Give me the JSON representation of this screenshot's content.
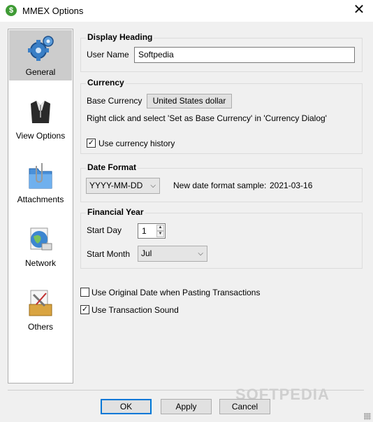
{
  "window": {
    "title": "MMEX Options",
    "app_icon": "$",
    "close_glyph": "✕"
  },
  "sidebar": {
    "items": [
      {
        "label": "General",
        "icon": "gear-icon",
        "active": true
      },
      {
        "label": "View Options",
        "icon": "view-options-icon",
        "active": false
      },
      {
        "label": "Attachments",
        "icon": "paperclip-folder-icon",
        "active": false
      },
      {
        "label": "Network",
        "icon": "globe-icon",
        "active": false
      },
      {
        "label": "Others",
        "icon": "toolbox-icon",
        "active": false
      }
    ]
  },
  "display_heading": {
    "title": "Display Heading",
    "user_name_label": "User Name",
    "user_name_value": "Softpedia"
  },
  "currency": {
    "title": "Currency",
    "base_currency_label": "Base Currency",
    "base_currency_button": "United States dollar",
    "hint": "Right click and select 'Set as Base Currency' in 'Currency Dialog'",
    "use_history_label": "Use currency history",
    "use_history_checked": true
  },
  "date_format": {
    "title": "Date Format",
    "selected_format": "YYYY-MM-DD",
    "sample_label": "New date format sample:",
    "sample_value": "2021-03-16"
  },
  "financial_year": {
    "title": "Financial Year",
    "start_day_label": "Start Day",
    "start_day_value": "1",
    "start_month_label": "Start Month",
    "start_month_value": "Jul"
  },
  "options": {
    "original_date_label": "Use Original Date when Pasting Transactions",
    "original_date_checked": false,
    "transaction_sound_label": "Use Transaction Sound",
    "transaction_sound_checked": true
  },
  "footer": {
    "ok": "OK",
    "apply": "Apply",
    "cancel": "Cancel",
    "watermark": "SOFTPEDIA"
  },
  "glyphs": {
    "check": "✓",
    "dropdown": "⌵",
    "spin_up": "▲",
    "spin_down": "▼"
  },
  "colors": {
    "accent": "#0078d7",
    "active_sidebar": "#cccccc"
  }
}
